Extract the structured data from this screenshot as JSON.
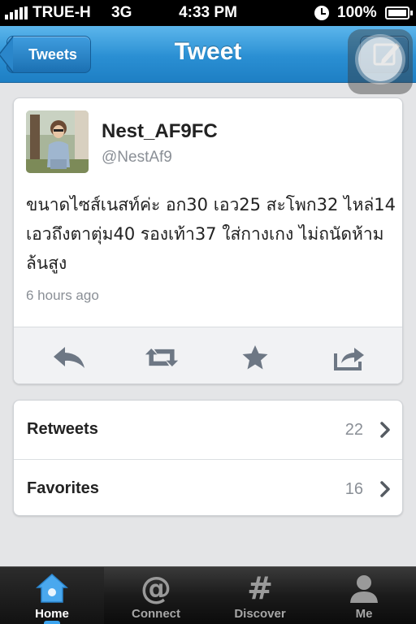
{
  "status_bar": {
    "carrier": "TRUE-H",
    "network": "3G",
    "time": "4:33 PM",
    "battery": "100%"
  },
  "nav": {
    "back_label": "Tweets",
    "title": "Tweet",
    "compose_icon": "compose-icon"
  },
  "tweet": {
    "name": "Nest_AF9FC",
    "handle": "@NestAf9",
    "text": "ขนาดไซส์เนสท์ค่ะ อก30 เอว25 สะโพก32 ไหล่14 เอวถึงตาตุ่ม40 รองเท้า37 ใส่กางเกง ไม่ถนัดห้ามล้นสูง",
    "time": "6 hours ago",
    "actions": [
      "reply-icon",
      "retweet-icon",
      "favorite-icon",
      "share-icon"
    ]
  },
  "stats": [
    {
      "label": "Retweets",
      "count": "22"
    },
    {
      "label": "Favorites",
      "count": "16"
    }
  ],
  "tab_bar": {
    "tabs": [
      {
        "label": "Home",
        "icon": "home-icon",
        "active": true
      },
      {
        "label": "Connect",
        "icon": "at-icon",
        "glyph": "@",
        "active": false
      },
      {
        "label": "Discover",
        "icon": "hash-icon",
        "glyph": "#",
        "active": false
      },
      {
        "label": "Me",
        "icon": "person-icon",
        "active": false
      }
    ]
  },
  "colors": {
    "nav_blue": "#2a8fd3",
    "active_tab_accent": "#3ba3ee",
    "muted_text": "#8a8f96"
  }
}
